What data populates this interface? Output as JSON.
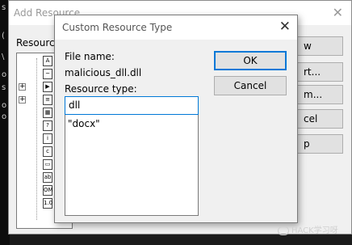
{
  "left_strip": {
    "glyphs": [
      "s",
      "(",
      "\\",
      "o",
      "s",
      "o",
      "o"
    ]
  },
  "back_dialog": {
    "title": "Add Resource",
    "close_glyph": "✕",
    "label": "Resource",
    "tree_icons": [
      "A",
      "~",
      "▶",
      "≡",
      "▦",
      "?",
      "i",
      "c",
      "▭",
      "ab",
      "OM",
      "1.0"
    ],
    "buttons": [
      "w",
      "rt...",
      "m...",
      "cel",
      "p"
    ]
  },
  "dialog": {
    "title": "Custom Resource Type",
    "close_glyph": "✕",
    "file_name_label": "File name:",
    "file_name_value": "malicious_dll.dll",
    "resource_type_label": "Resource type:",
    "resource_type_value": "dll",
    "list_items": [
      "\"docx\""
    ],
    "ok_label": "OK",
    "cancel_label": "Cancel"
  },
  "watermark": {
    "text": "HACK学习呀"
  }
}
